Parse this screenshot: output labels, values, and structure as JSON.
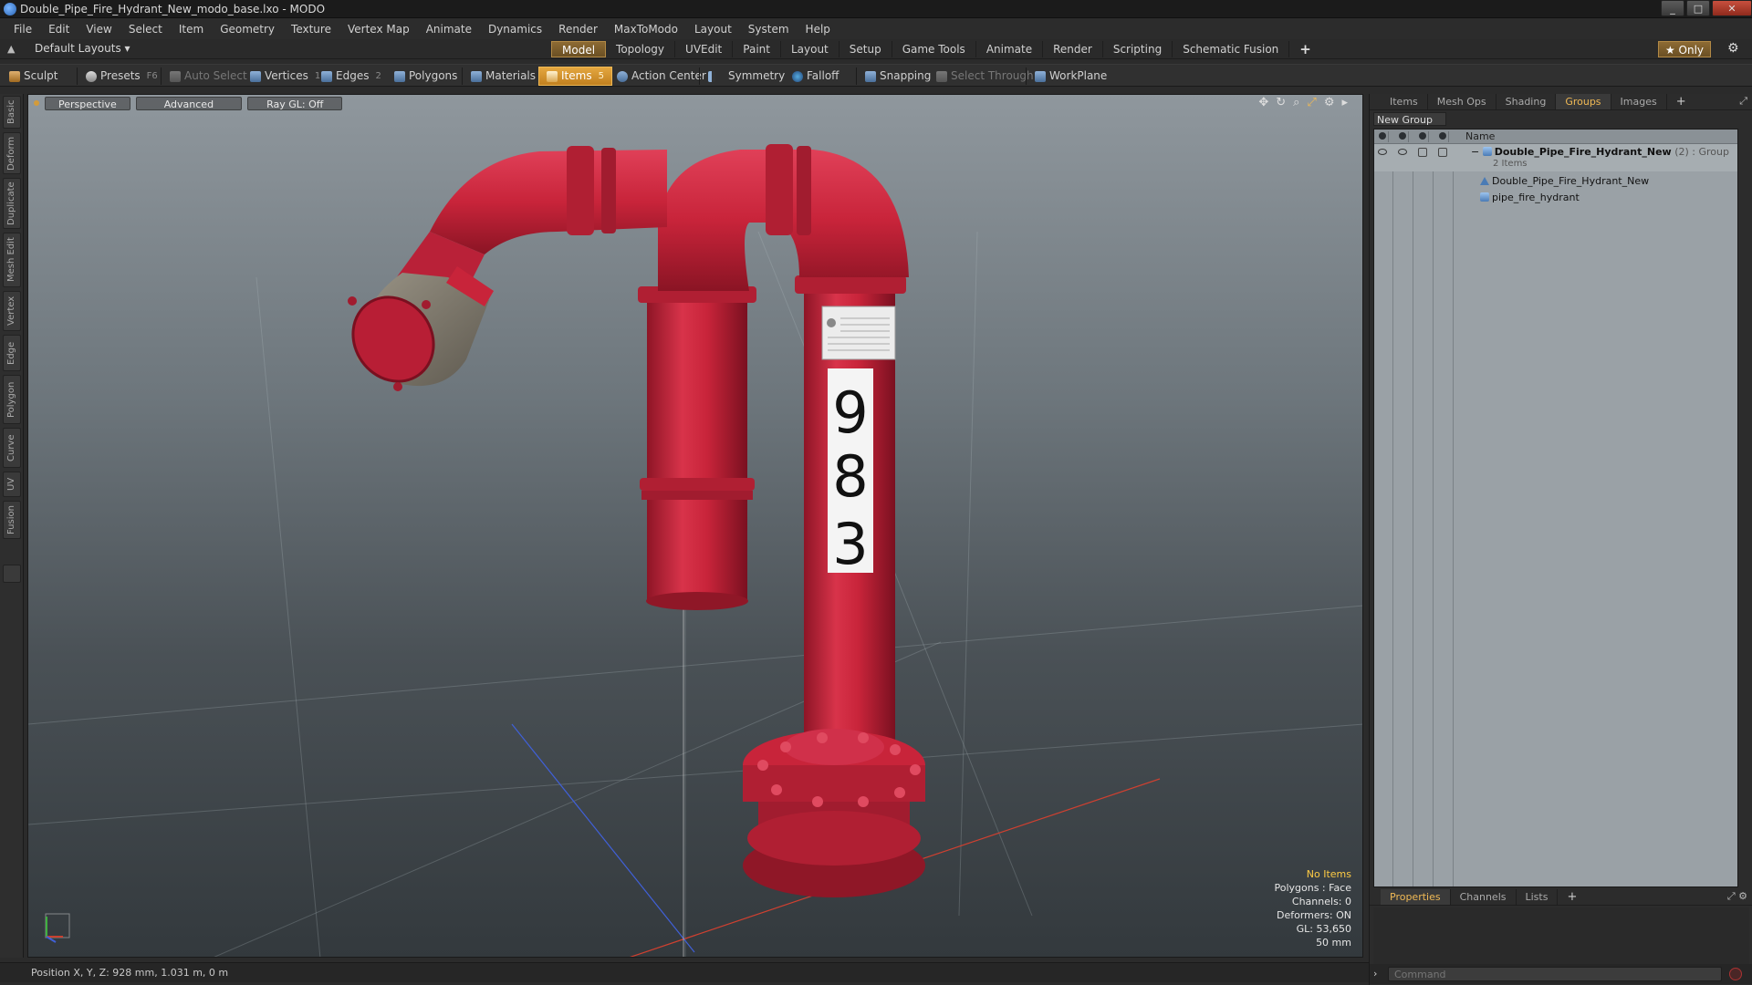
{
  "window": {
    "title": "Double_Pipe_Fire_Hydrant_New_modo_base.lxo - MODO",
    "min": "_",
    "max": "□",
    "close": "✕"
  },
  "menu": [
    "File",
    "Edit",
    "View",
    "Select",
    "Item",
    "Geometry",
    "Texture",
    "Vertex Map",
    "Animate",
    "Dynamics",
    "Render",
    "MaxToModo",
    "Layout",
    "System",
    "Help"
  ],
  "layoutbar": {
    "layouts_label": "Default Layouts ▾",
    "tabs": [
      "Model",
      "Topology",
      "UVEdit",
      "Paint",
      "Layout",
      "Setup",
      "Game Tools",
      "Animate",
      "Render",
      "Scripting",
      "Schematic Fusion"
    ],
    "active_tab": "Model",
    "add_tab": "+",
    "only_label": "★ Only"
  },
  "toolbar": {
    "sculpt": "Sculpt",
    "presets": "Presets",
    "presets_key": "F6",
    "auto_select": "Auto Select",
    "vertices": "Vertices",
    "vertices_key": "1",
    "edges": "Edges",
    "edges_key": "2",
    "polygons": "Polygons",
    "materials": "Materials",
    "items": "Items",
    "items_key": "5",
    "action_center": "Action Center",
    "symmetry": "Symmetry",
    "falloff": "Falloff",
    "snapping": "Snapping",
    "select_through": "Select Through",
    "workplane": "WorkPlane"
  },
  "left_tabs": [
    "Basic",
    "Deform",
    "Duplicate",
    "Mesh Edit",
    "Vertex",
    "Edge",
    "Polygon",
    "Curve",
    "UV",
    "Fusion"
  ],
  "viewport": {
    "view_mode": "Perspective",
    "shading": "Advanced",
    "raygl": "Ray GL: Off",
    "info": {
      "selection": "No Items",
      "polygons": "Polygons : Face",
      "channels": "Channels: 0",
      "deformers": "Deformers: ON",
      "gl": "GL: 53,650",
      "grid": "50 mm"
    },
    "hydrant_numbers": [
      "9",
      "8",
      "3"
    ]
  },
  "status": {
    "position": "Position X, Y, Z:  928 mm, 1.031 m, 0 m"
  },
  "right_panel": {
    "tabs": [
      "Items",
      "Mesh Ops",
      "Shading",
      "Groups",
      "Images"
    ],
    "active_tab": "Groups",
    "add_tab": "+",
    "new_group": "New Group",
    "column_name": "Name",
    "tree": {
      "group_name": "Double_Pipe_Fire_Hydrant_New",
      "group_suffix": " (2) : Group",
      "group_count": "2 Items",
      "children": [
        "Double_Pipe_Fire_Hydrant_New",
        "pipe_fire_hydrant"
      ]
    },
    "bottom_tabs": [
      "Properties",
      "Channels",
      "Lists"
    ],
    "bottom_active": "Properties",
    "bottom_add": "+",
    "command_placeholder": "Command"
  },
  "colors": {
    "accent": "#e5a740",
    "hydrant_red": "#c8243a",
    "active_tab_text": "#f0b955"
  }
}
